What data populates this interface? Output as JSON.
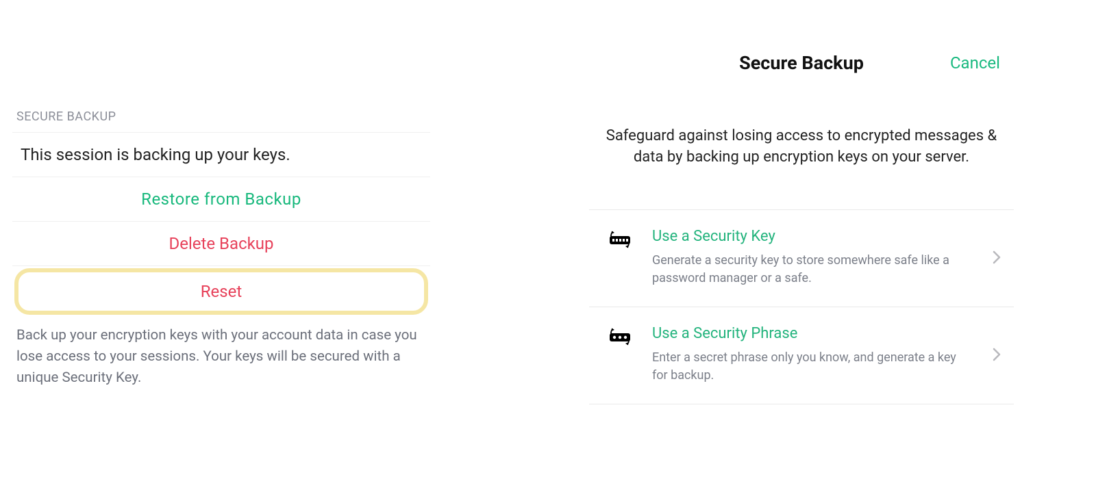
{
  "left": {
    "section_header": "SECURE BACKUP",
    "status_text": "This session is backing up your keys.",
    "restore_label": "Restore from Backup",
    "delete_label": "Delete Backup",
    "reset_label": "Reset",
    "help_text": "Back up your encryption keys with your account data in case you lose access to your sessions. Your keys will be secured with a unique Security Key."
  },
  "right": {
    "title": "Secure Backup",
    "cancel_label": "Cancel",
    "intro_text": "Safeguard against losing access to encrypted messages & data by backing up encryption keys on your server.",
    "options": [
      {
        "title": "Use a Security Key",
        "desc": "Generate a security key to store somewhere safe like a password manager or a safe."
      },
      {
        "title": "Use a Security Phrase",
        "desc": "Enter a secret phrase only you know, and generate a key for backup."
      }
    ]
  },
  "colors": {
    "accent_green": "#17b87c",
    "danger_red": "#e7415a",
    "highlight": "#f5e6a4",
    "muted_text": "#6b6f7a"
  }
}
